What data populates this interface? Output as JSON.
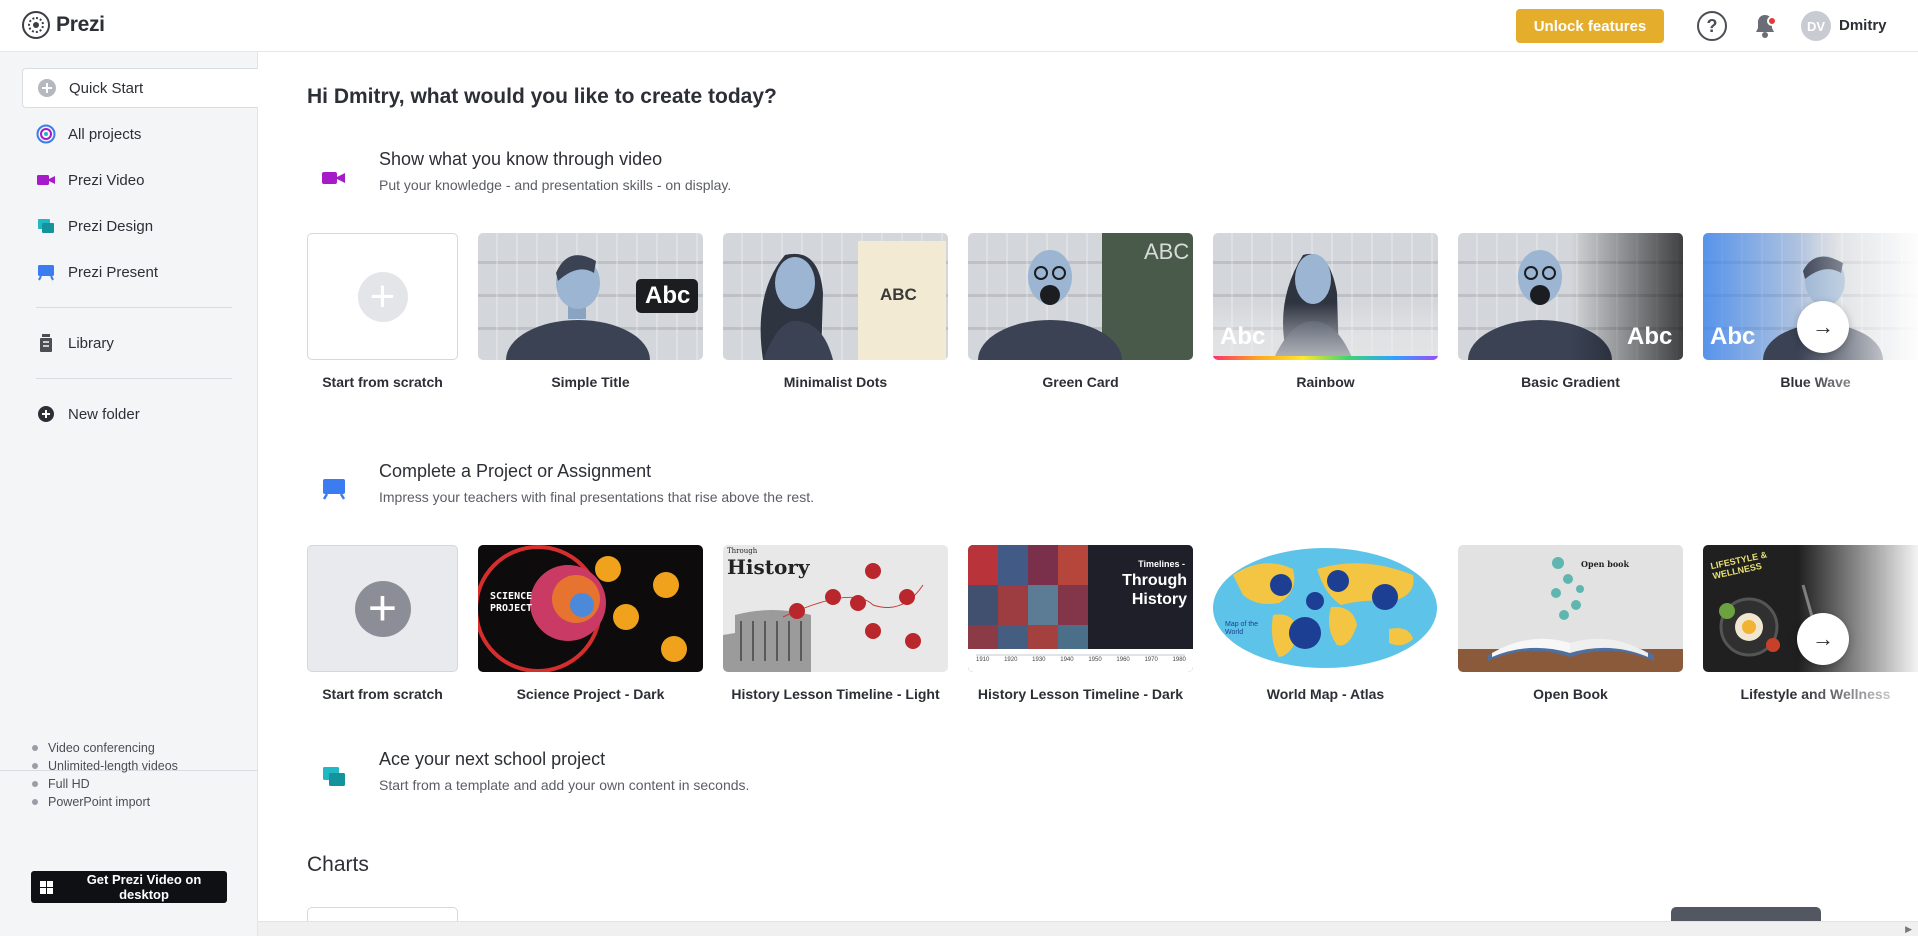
{
  "app": {
    "logo_text": "Prezi",
    "unlock_label": "Unlock features",
    "help_glyph": "?",
    "avatar_initials": "DV",
    "user_name": "Dmitry"
  },
  "sidebar": {
    "items": [
      {
        "label": "Quick Start",
        "icon": "plus-circle-icon"
      },
      {
        "label": "All projects",
        "icon": "spiral-icon"
      },
      {
        "label": "Prezi Video",
        "icon": "video-camera-icon"
      },
      {
        "label": "Prezi Design",
        "icon": "design-icon"
      },
      {
        "label": "Prezi Present",
        "icon": "presentation-icon"
      },
      {
        "label": "Library",
        "icon": "trash-bin-icon"
      },
      {
        "label": "New folder",
        "icon": "plus-circle-icon"
      }
    ],
    "features": [
      "Video conferencing",
      "Unlimited-length videos",
      "Full HD",
      "PowerPoint import"
    ],
    "desktop_button": "Get Prezi Video on desktop"
  },
  "main": {
    "greeting": "Hi Dmitry, what would you like to create today?",
    "sections": [
      {
        "title": "Show what you know through video",
        "subtitle": "Put your knowledge - and presentation skills - on display.",
        "icon": "video-camera-icon",
        "cards": [
          "Start from scratch",
          "Simple Title",
          "Minimalist Dots",
          "Green Card",
          "Rainbow",
          "Basic Gradient",
          "Blue Wave"
        ]
      },
      {
        "title": "Complete a Project or Assignment",
        "subtitle": "Impress your teachers with final presentations that rise above the rest.",
        "icon": "presentation-icon",
        "cards": [
          "Start from scratch",
          "Science Project - Dark",
          "History Lesson Timeline - Light",
          "History Lesson Timeline - Dark",
          "World Map - Atlas",
          "Open Book",
          "Lifestyle and Wellness"
        ]
      },
      {
        "title": "Ace your next school project",
        "subtitle": "Start from a template and add your own content in seconds.",
        "icon": "design-icon"
      }
    ],
    "charts_title": "Charts"
  },
  "thumb_text": {
    "abc": "Abc",
    "abc_caps": "ABC",
    "science": "SCIENCE PROJECT",
    "history_small": "Through",
    "history": "History",
    "timelines": "Timelines -",
    "through_history": "Through History",
    "map_text": "Map of the World",
    "open_book": "Open book",
    "lifestyle": "LIFESTYLE & WELLNESS",
    "years": [
      "1910",
      "1920",
      "1930",
      "1940",
      "1950",
      "1960",
      "1970",
      "1980"
    ]
  },
  "colors": {
    "accent": "#e4ad2b",
    "video": "#a51bc7",
    "design": "#1fb8c3",
    "present": "#3b7df0"
  }
}
